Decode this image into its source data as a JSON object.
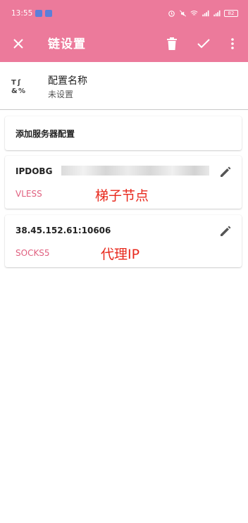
{
  "status_bar": {
    "time": "13:55",
    "battery": "82"
  },
  "toolbar": {
    "title": "链设置",
    "close_icon": "close-icon",
    "delete_icon": "trash-icon",
    "confirm_icon": "check-icon",
    "more_icon": "more-vert-icon"
  },
  "config_name": {
    "title": "配置名称",
    "value": "未设置"
  },
  "add_server": {
    "label": "添加服务器配置"
  },
  "servers": [
    {
      "address": "IPDOBG",
      "type": "VLESS",
      "annotation": "梯子节点"
    },
    {
      "address": "38.45.152.61:10606",
      "type": "SOCKS5",
      "annotation": "代理IP"
    }
  ],
  "colors": {
    "accent": "#ec7a9b",
    "type_text": "#e0607f",
    "annotation": "#e8281c"
  }
}
